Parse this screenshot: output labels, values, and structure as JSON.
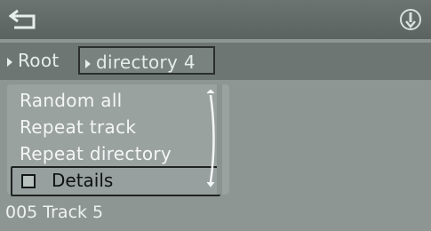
{
  "topbar": {
    "back_icon": "back-arrow-icon",
    "info_icon": "info-icon"
  },
  "breadcrumb": {
    "root": "Root",
    "current": "directory 4"
  },
  "menu": {
    "items": [
      "Random all",
      "Repeat track",
      "Repeat directory"
    ],
    "selected": {
      "label": "Details",
      "icon": "checkbox-icon",
      "checked": false
    }
  },
  "status": {
    "track": "005 Track 5"
  },
  "colors": {
    "background": "#8e9694",
    "bar": "#6e7674",
    "text": "#f3f6f5",
    "selection_border": "#1e2221"
  }
}
